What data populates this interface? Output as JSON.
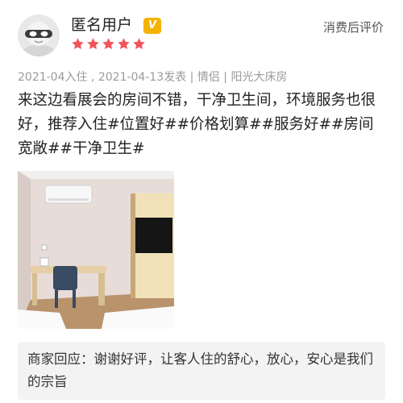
{
  "user": {
    "name": "匿名用户",
    "badge": "V",
    "rating": 5,
    "avatar_icon": "anonymous-mask-avatar"
  },
  "review_type": "消费后评价",
  "meta": "2021-04入住 , 2021-04-13发表 | 情侣 | 阳光大床房",
  "review_text": "来这边看展会的房间不错，干净卫生间，环境服务也很好，推荐入住#位置好##价格划算##服务好##房间宽敞##干净卫生#",
  "photo": {
    "icon": "hotel-room-photo"
  },
  "merchant_reply": "商家回应：谢谢好评，让客人住的舒心，放心，安心是我们的宗旨",
  "colors": {
    "star": "#f2545b",
    "badge": "#f5b100",
    "meta": "#9a9a9a",
    "reply_bg": "#f3f3f3"
  }
}
